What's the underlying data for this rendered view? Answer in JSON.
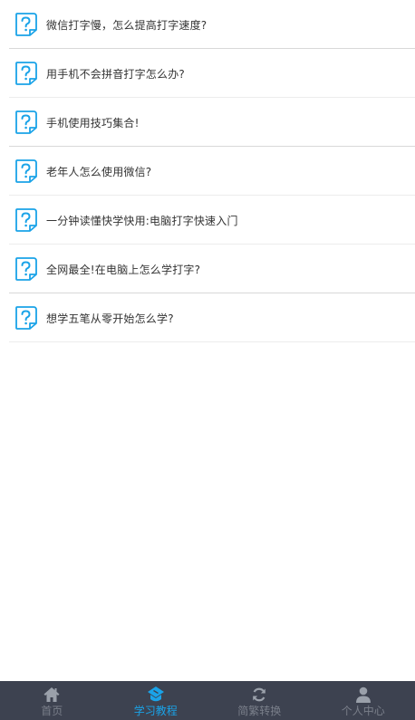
{
  "colors": {
    "accent": "#1aa3e8",
    "tabbar_bg": "#3d4250",
    "tab_inactive": "#7a7f8a",
    "text": "#333333"
  },
  "tutorials": {
    "items": [
      {
        "title": "微信打字慢，怎么提高打字速度?",
        "icon": "question-doc-icon"
      },
      {
        "title": "用手机不会拼音打字怎么办?",
        "icon": "question-doc-icon"
      },
      {
        "title": "手机使用技巧集合!",
        "icon": "question-doc-icon"
      },
      {
        "title": "老年人怎么使用微信?",
        "icon": "question-doc-icon"
      },
      {
        "title": "一分钟读懂快学快用:电脑打字快速入门",
        "icon": "question-doc-icon"
      },
      {
        "title": "全网最全!在电脑上怎么学打字?",
        "icon": "question-doc-icon"
      },
      {
        "title": "想学五笔从零开始怎么学?",
        "icon": "question-doc-icon"
      }
    ]
  },
  "tabbar": {
    "active": "学习教程",
    "tabs": [
      {
        "label": "首页",
        "icon": "home-icon"
      },
      {
        "label": "学习教程",
        "icon": "tutorial-icon"
      },
      {
        "label": "简繁转换",
        "icon": "convert-icon"
      },
      {
        "label": "个人中心",
        "icon": "user-icon"
      }
    ]
  }
}
